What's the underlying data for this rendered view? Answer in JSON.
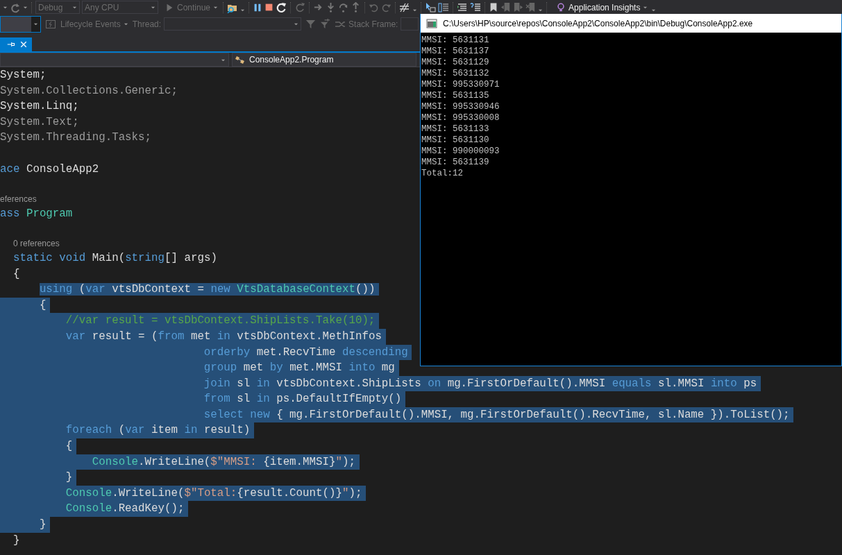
{
  "toolbar": {
    "configuration": {
      "value": "Debug",
      "disabled": true
    },
    "platform": {
      "value": "Any CPU",
      "disabled": true
    },
    "continue_button": {
      "label": "Continue",
      "disabled": true
    },
    "insights_button": {
      "label": "Application Insights",
      "disabled": false
    }
  },
  "debug_location_bar": {
    "lifecycle_events": "Lifecycle Events",
    "thread_label": "Thread:",
    "stack_frame_label": "Stack Frame:"
  },
  "document_tabs": [
    {
      "selected": true
    }
  ],
  "navigation_bar": {
    "type_member": "ConsoleApp2.Program"
  },
  "editor": {
    "lines": [
      {
        "kind": "code",
        "selected": false,
        "tokens": [
          {
            "kind": "plain",
            "text": "System;"
          }
        ]
      },
      {
        "kind": "code",
        "selected": false,
        "tokens": [
          {
            "kind": "dim",
            "text": "System.Collections.Generic;"
          }
        ]
      },
      {
        "kind": "code",
        "selected": false,
        "tokens": [
          {
            "kind": "plain",
            "text": "System.Linq;"
          }
        ]
      },
      {
        "kind": "code",
        "selected": false,
        "tokens": [
          {
            "kind": "dim",
            "text": "System.Text;"
          }
        ]
      },
      {
        "kind": "code",
        "selected": false,
        "tokens": [
          {
            "kind": "dim",
            "text": "System.Threading.Tasks;"
          }
        ]
      },
      {
        "kind": "blank",
        "selected": false
      },
      {
        "kind": "code",
        "selected": false,
        "tokens": [
          {
            "kind": "kw",
            "text": "ace"
          },
          {
            "kind": "plain",
            "text": " ConsoleApp2"
          }
        ]
      },
      {
        "kind": "blank",
        "selected": false
      },
      {
        "kind": "codelens",
        "selected": false,
        "text": "eferences"
      },
      {
        "kind": "code",
        "selected": false,
        "tokens": [
          {
            "kind": "kw",
            "text": "ass"
          },
          {
            "kind": "type",
            "text": " Program"
          }
        ]
      },
      {
        "kind": "blank",
        "selected": false
      },
      {
        "kind": "codelens",
        "selected": false,
        "text": "  0 references"
      },
      {
        "kind": "code",
        "selected": false,
        "tokens": [
          {
            "kind": "kw",
            "text": "  static void"
          },
          {
            "kind": "plain",
            "text": " Main("
          },
          {
            "kind": "kw",
            "text": "string"
          },
          {
            "kind": "plain",
            "text": "[] args)"
          }
        ]
      },
      {
        "kind": "code",
        "selected": false,
        "tokens": [
          {
            "kind": "plain",
            "text": "  {"
          }
        ]
      },
      {
        "kind": "code",
        "selected": true,
        "tokens": [
          {
            "kind": "kw",
            "text": "      using"
          },
          {
            "kind": "plain",
            "text": " ("
          },
          {
            "kind": "kw",
            "text": "var"
          },
          {
            "kind": "plain",
            "text": " vtsDbContext = "
          },
          {
            "kind": "kw",
            "text": "new"
          },
          {
            "kind": "type",
            "text": " VtsDatabaseContext"
          },
          {
            "kind": "plain",
            "text": "())"
          }
        ]
      },
      {
        "kind": "code",
        "selected": true,
        "tokens": [
          {
            "kind": "plain",
            "text": "      {"
          }
        ]
      },
      {
        "kind": "code",
        "selected": true,
        "tokens": [
          {
            "kind": "comment",
            "text": "          //var result = vtsDbContext.ShipLists.Take(10);"
          }
        ]
      },
      {
        "kind": "code",
        "selected": true,
        "tokens": [
          {
            "kind": "kw",
            "text": "          var"
          },
          {
            "kind": "plain",
            "text": " result = ("
          },
          {
            "kind": "kw",
            "text": "from"
          },
          {
            "kind": "plain",
            "text": " met "
          },
          {
            "kind": "kw",
            "text": "in"
          },
          {
            "kind": "plain",
            "text": " vtsDbContext.MethInfos"
          }
        ]
      },
      {
        "kind": "code",
        "selected": true,
        "tokens": [
          {
            "kind": "kw",
            "text": "                               orderby"
          },
          {
            "kind": "plain",
            "text": " met.RecvTime "
          },
          {
            "kind": "kw",
            "text": "descending"
          }
        ]
      },
      {
        "kind": "code",
        "selected": true,
        "tokens": [
          {
            "kind": "kw",
            "text": "                               group"
          },
          {
            "kind": "plain",
            "text": " met "
          },
          {
            "kind": "kw",
            "text": "by"
          },
          {
            "kind": "plain",
            "text": " met.MMSI "
          },
          {
            "kind": "kw",
            "text": "into"
          },
          {
            "kind": "plain",
            "text": " mg"
          }
        ]
      },
      {
        "kind": "code",
        "selected": true,
        "tokens": [
          {
            "kind": "kw",
            "text": "                               join"
          },
          {
            "kind": "plain",
            "text": " sl "
          },
          {
            "kind": "kw",
            "text": "in"
          },
          {
            "kind": "plain",
            "text": " vtsDbContext.ShipLists "
          },
          {
            "kind": "kw",
            "text": "on"
          },
          {
            "kind": "plain",
            "text": " mg.FirstOrDefault().MMSI "
          },
          {
            "kind": "kw",
            "text": "equals"
          },
          {
            "kind": "plain",
            "text": " sl.MMSI "
          },
          {
            "kind": "kw",
            "text": "into"
          },
          {
            "kind": "plain",
            "text": " ps"
          }
        ]
      },
      {
        "kind": "code",
        "selected": true,
        "tokens": [
          {
            "kind": "kw",
            "text": "                               from"
          },
          {
            "kind": "plain",
            "text": " sl "
          },
          {
            "kind": "kw",
            "text": "in"
          },
          {
            "kind": "plain",
            "text": " ps.DefaultIfEmpty()"
          }
        ]
      },
      {
        "kind": "code",
        "selected": true,
        "tokens": [
          {
            "kind": "kw",
            "text": "                               select new"
          },
          {
            "kind": "plain",
            "text": " { mg.FirstOrDefault().MMSI, mg.FirstOrDefault().RecvTime, sl.Name }).ToList();"
          }
        ]
      },
      {
        "kind": "code",
        "selected": true,
        "tokens": [
          {
            "kind": "kw",
            "text": "          foreach"
          },
          {
            "kind": "plain",
            "text": " ("
          },
          {
            "kind": "kw",
            "text": "var"
          },
          {
            "kind": "plain",
            "text": " item "
          },
          {
            "kind": "kw",
            "text": "in"
          },
          {
            "kind": "plain",
            "text": " result)"
          }
        ]
      },
      {
        "kind": "code",
        "selected": true,
        "tokens": [
          {
            "kind": "plain",
            "text": "          {"
          }
        ]
      },
      {
        "kind": "code",
        "selected": true,
        "tokens": [
          {
            "kind": "type",
            "text": "              Console"
          },
          {
            "kind": "plain",
            "text": ".WriteLine("
          },
          {
            "kind": "string",
            "text": "$\"MMSI: "
          },
          {
            "kind": "plain",
            "text": "{item.MMSI}"
          },
          {
            "kind": "string",
            "text": "\""
          },
          {
            "kind": "plain",
            "text": ");"
          }
        ]
      },
      {
        "kind": "code",
        "selected": true,
        "tokens": [
          {
            "kind": "plain",
            "text": "          }"
          }
        ]
      },
      {
        "kind": "code",
        "selected": true,
        "tokens": [
          {
            "kind": "type",
            "text": "          Console"
          },
          {
            "kind": "plain",
            "text": ".WriteLine("
          },
          {
            "kind": "string",
            "text": "$\"Total:"
          },
          {
            "kind": "plain",
            "text": "{result.Count()}"
          },
          {
            "kind": "string",
            "text": "\""
          },
          {
            "kind": "plain",
            "text": ");"
          }
        ]
      },
      {
        "kind": "code",
        "selected": true,
        "tokens": [
          {
            "kind": "type",
            "text": "          Console"
          },
          {
            "kind": "plain",
            "text": ".ReadKey();"
          }
        ]
      },
      {
        "kind": "code",
        "selected": true,
        "tokens": [
          {
            "kind": "plain",
            "text": "      }"
          }
        ]
      },
      {
        "kind": "code",
        "selected": false,
        "tokens": [
          {
            "kind": "plain",
            "text": "  }"
          }
        ]
      }
    ]
  },
  "console_window": {
    "title": "C:\\Users\\HP\\source\\repos\\ConsoleApp2\\ConsoleApp2\\bin\\Debug\\ConsoleApp2.exe",
    "output": [
      "MMSI: 5631131",
      "MMSI: 5631137",
      "MMSI: 5631129",
      "MMSI: 5631132",
      "MMSI: 995330971",
      "MMSI: 5631135",
      "MMSI: 995330946",
      "MMSI: 995330008",
      "MMSI: 5631133",
      "MMSI: 5631130",
      "MMSI: 990000093",
      "MMSI: 5631139",
      "Total:12"
    ]
  }
}
